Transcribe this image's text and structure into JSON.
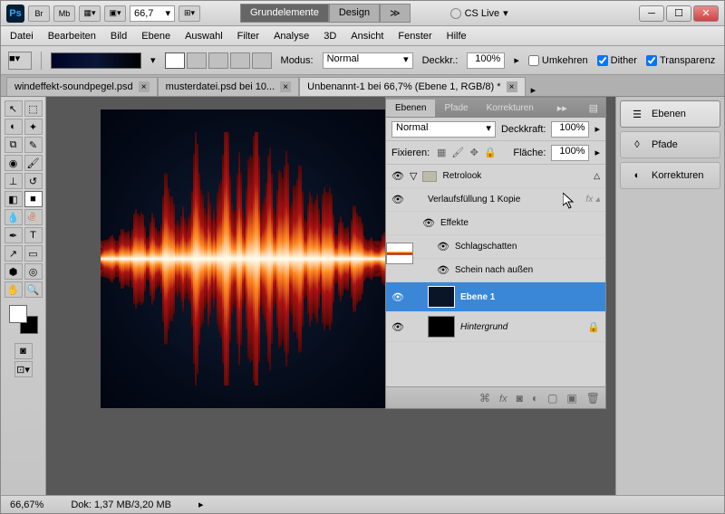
{
  "titlebar": {
    "ps": "Ps",
    "br": "Br",
    "mb": "Mb",
    "zoom": "66,7",
    "ws_active": "Grundelemente",
    "ws_other": "Design",
    "cslive": "CS Live"
  },
  "menu": [
    "Datei",
    "Bearbeiten",
    "Bild",
    "Ebene",
    "Auswahl",
    "Filter",
    "Analyse",
    "3D",
    "Ansicht",
    "Fenster",
    "Hilfe"
  ],
  "options": {
    "mode_label": "Modus:",
    "mode": "Normal",
    "opacity_label": "Deckkr.:",
    "opacity": "100%",
    "reverse": "Umkehren",
    "dither": "Dither",
    "trans": "Transparenz"
  },
  "tabs": [
    {
      "title": "windeffekt-soundpegel.psd",
      "active": false
    },
    {
      "title": "musterdatei.psd bei 10...",
      "active": false
    },
    {
      "title": "Unbenannt-1 bei 66,7% (Ebene 1, RGB/8) *",
      "active": true
    }
  ],
  "layers_panel": {
    "tabs": [
      "Ebenen",
      "Pfade",
      "Korrekturen"
    ],
    "blend": "Normal",
    "opacity_label": "Deckkraft:",
    "opacity": "100%",
    "lock_label": "Fixieren:",
    "fill_label": "Fläche:",
    "fill": "100%",
    "items": {
      "group": "Retrolook",
      "layer1": "Verlaufsfüllung 1 Kopie",
      "effects": "Effekte",
      "fx1": "Schlagschatten",
      "fx2": "Schein nach außen",
      "layer2": "Ebene 1",
      "bg": "Hintergrund"
    }
  },
  "dock": [
    "Ebenen",
    "Pfade",
    "Korrekturen"
  ],
  "status": {
    "zoom": "66,67%",
    "doc": "Dok: 1,37 MB/3,20 MB"
  }
}
